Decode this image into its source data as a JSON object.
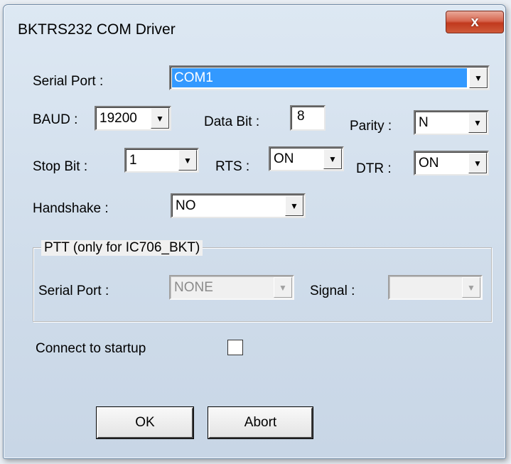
{
  "window": {
    "title": "BKTRS232 COM Driver",
    "close_glyph": "x"
  },
  "serial_port": {
    "label": "Serial Port  :",
    "value": "COM1"
  },
  "baud": {
    "label": "BAUD :",
    "value": "19200"
  },
  "data_bit": {
    "label": "Data Bit :",
    "value": "8"
  },
  "parity": {
    "label": "Parity :",
    "value": "N"
  },
  "stop_bit": {
    "label": "Stop Bit :",
    "value": "1"
  },
  "rts": {
    "label": "RTS :",
    "value": "ON"
  },
  "dtr": {
    "label": "DTR :",
    "value": "ON"
  },
  "handshake": {
    "label": "Handshake  :",
    "value": "NO"
  },
  "ptt": {
    "group_title": "PTT (only for IC706_BKT)",
    "serial_port_label": "Serial Port  :",
    "serial_port_value": "NONE",
    "signal_label": "Signal :",
    "signal_value": ""
  },
  "connect": {
    "label": "Connect to startup",
    "checked": false
  },
  "buttons": {
    "ok": "OK",
    "abort": "Abort"
  },
  "icons": {
    "dropdown": "chevron-down-icon",
    "close": "close-icon"
  },
  "colors": {
    "selection": "#3399ff",
    "close_button": "#c1391d",
    "dialog_bg": "#f0f0f0"
  }
}
